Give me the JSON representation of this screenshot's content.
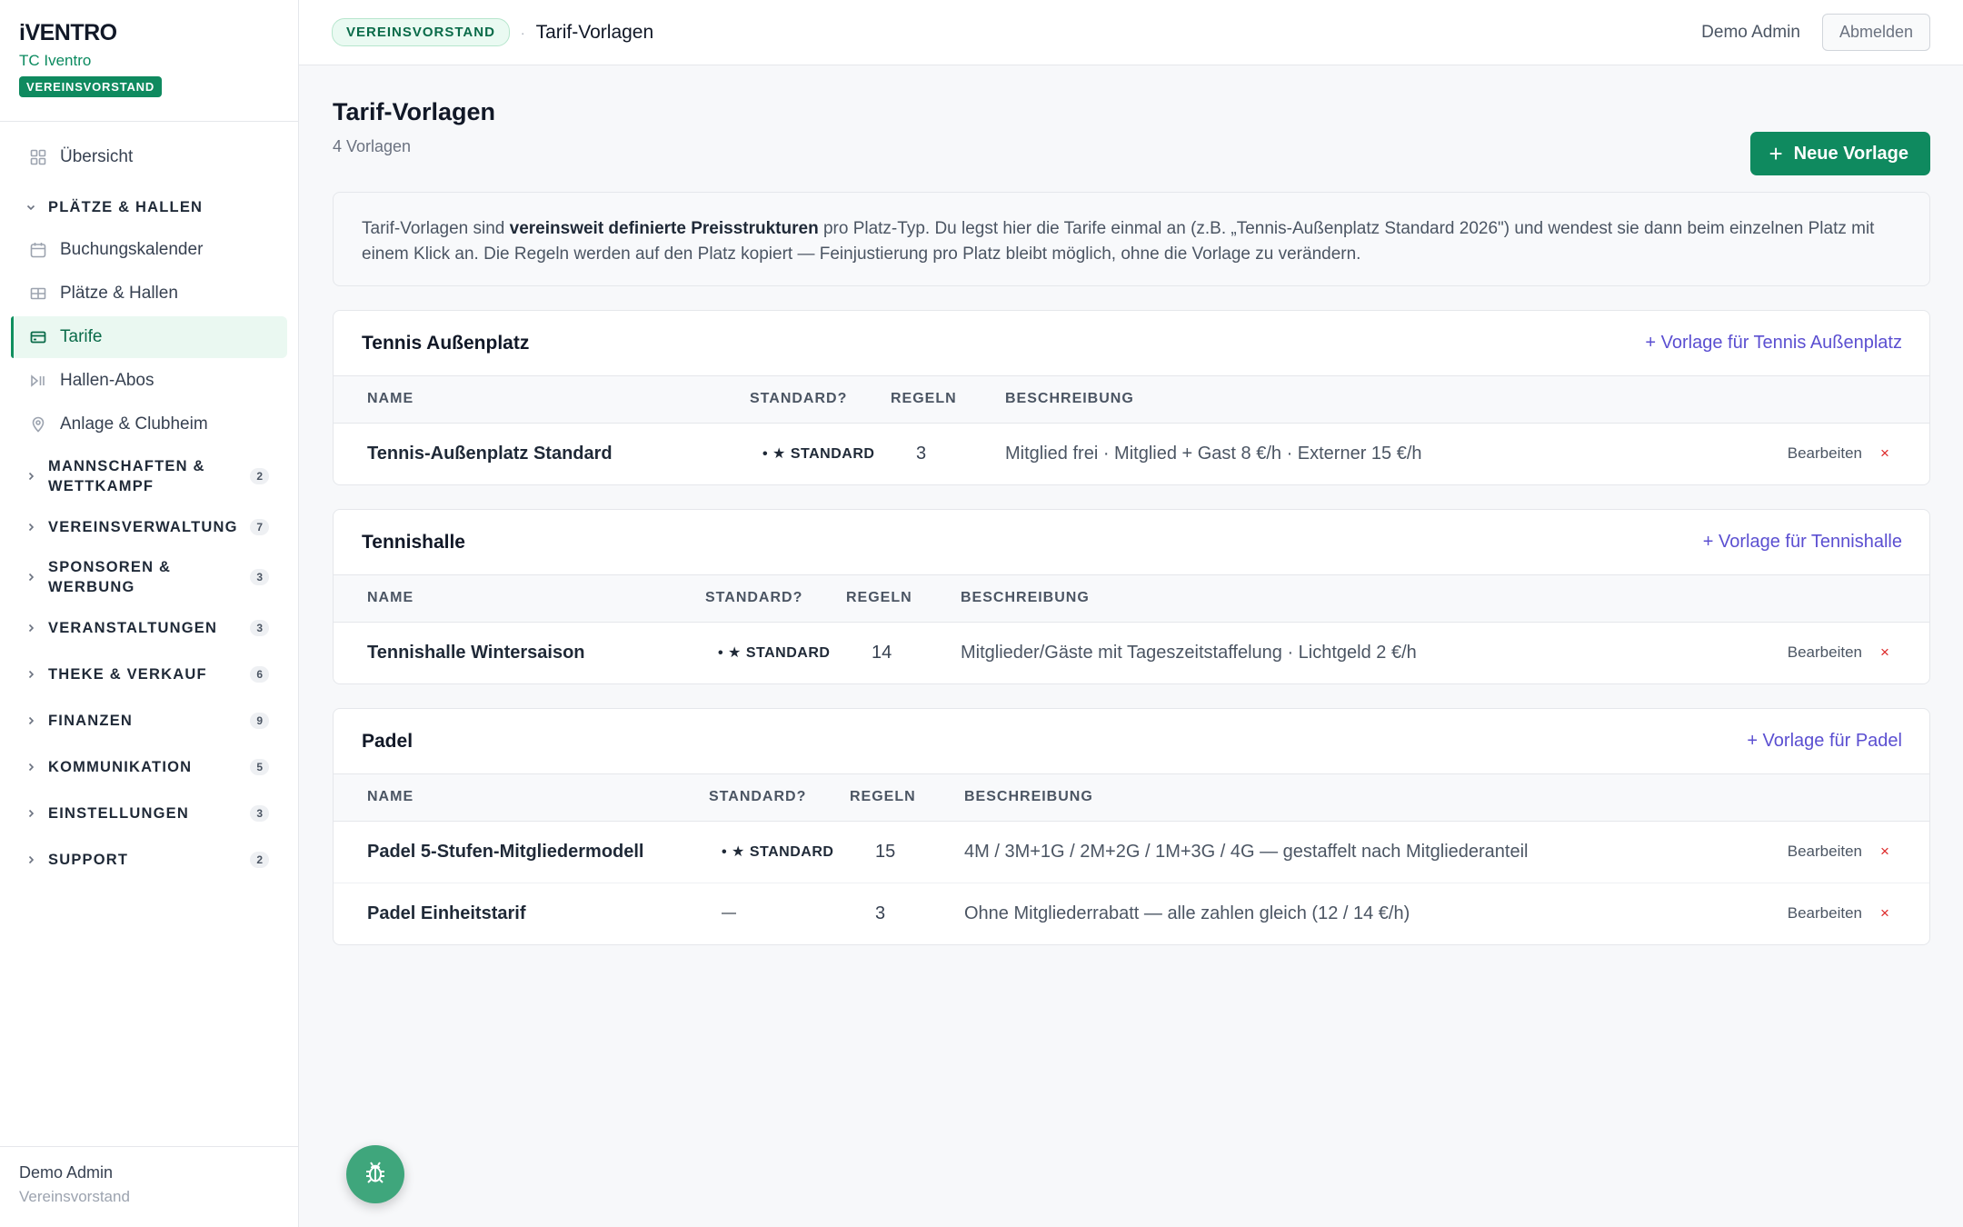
{
  "brand": {
    "logo": "iVENTRO",
    "club": "TC Iventro",
    "role": "VEREINSVORSTAND"
  },
  "nav": {
    "overview": "Übersicht",
    "section_open": "PLÄTZE & HALLEN",
    "sub_items": [
      "Buchungskalender",
      "Plätze & Hallen",
      "Tarife",
      "Hallen-Abos",
      "Anlage & Clubheim"
    ],
    "sections": [
      {
        "title": "MANNSCHAFTEN & WETTKAMPF",
        "count": "2"
      },
      {
        "title": "VEREINSVERWALTUNG",
        "count": "7"
      },
      {
        "title": "SPONSOREN & WERBUNG",
        "count": "3"
      },
      {
        "title": "VERANSTALTUNGEN",
        "count": "3"
      },
      {
        "title": "THEKE & VERKAUF",
        "count": "6"
      },
      {
        "title": "FINANZEN",
        "count": "9"
      },
      {
        "title": "KOMMUNIKATION",
        "count": "5"
      },
      {
        "title": "EINSTELLUNGEN",
        "count": "3"
      },
      {
        "title": "SUPPORT",
        "count": "2"
      }
    ]
  },
  "sidebar_footer": {
    "name": "Demo Admin",
    "role": "Vereinsvorstand"
  },
  "topbar": {
    "badge": "VEREINSVORSTAND",
    "sep": "·",
    "current": "Tarif-Vorlagen",
    "user": "Demo Admin",
    "logout": "Abmelden"
  },
  "page": {
    "title": "Tarif-Vorlagen",
    "subtitle": "4 Vorlagen",
    "new_button": "Neue Vorlage",
    "info_pre": "Tarif-Vorlagen sind ",
    "info_bold": "vereinsweit definierte Preisstrukturen",
    "info_post": " pro Platz-Typ. Du legst hier die Tarife einmal an (z.B. „Tennis-Außenplatz Standard 2026\") und wendest sie dann beim einzelnen Platz mit einem Klick an. Die Regeln werden auf den Platz kopiert — Feinjustierung pro Platz bleibt möglich, ohne die Vorlage zu verändern."
  },
  "columns": {
    "name": "NAME",
    "standard": "STANDARD?",
    "rules": "REGELN",
    "description": "BESCHREIBUNG"
  },
  "actions": {
    "edit": "Bearbeiten",
    "delete": "×"
  },
  "groups": [
    {
      "title": "Tennis Außenplatz",
      "link": "+ Vorlage für Tennis Außenplatz",
      "rows": [
        {
          "name": "Tennis-Außenplatz Standard",
          "standard": "• ★ STANDARD",
          "rules": "3",
          "description": "Mitglied frei · Mitglied + Gast 8 €/h · Externer 15 €/h"
        }
      ]
    },
    {
      "title": "Tennishalle",
      "link": "+ Vorlage für Tennishalle",
      "rows": [
        {
          "name": "Tennishalle Wintersaison",
          "standard": "• ★ STANDARD",
          "rules": "14",
          "description": "Mitglieder/Gäste mit Tageszeitstaffelung · Lichtgeld 2 €/h"
        }
      ]
    },
    {
      "title": "Padel",
      "link": "+ Vorlage für Padel",
      "rows": [
        {
          "name": "Padel 5-Stufen-Mitgliedermodell",
          "standard": "• ★ STANDARD",
          "rules": "15",
          "description": "4M / 3M+1G / 2M+2G / 1M+3G / 4G — gestaffelt nach Mitgliederanteil"
        },
        {
          "name": "Padel Einheitstarif",
          "standard": "—",
          "rules": "3",
          "description": "Ohne Mitgliederrabatt — alle zahlen gleich (12 / 14 €/h)"
        }
      ]
    }
  ],
  "colors": {
    "accent": "#0f8a5f",
    "link": "#5b4fd1",
    "danger": "#dc2626"
  }
}
